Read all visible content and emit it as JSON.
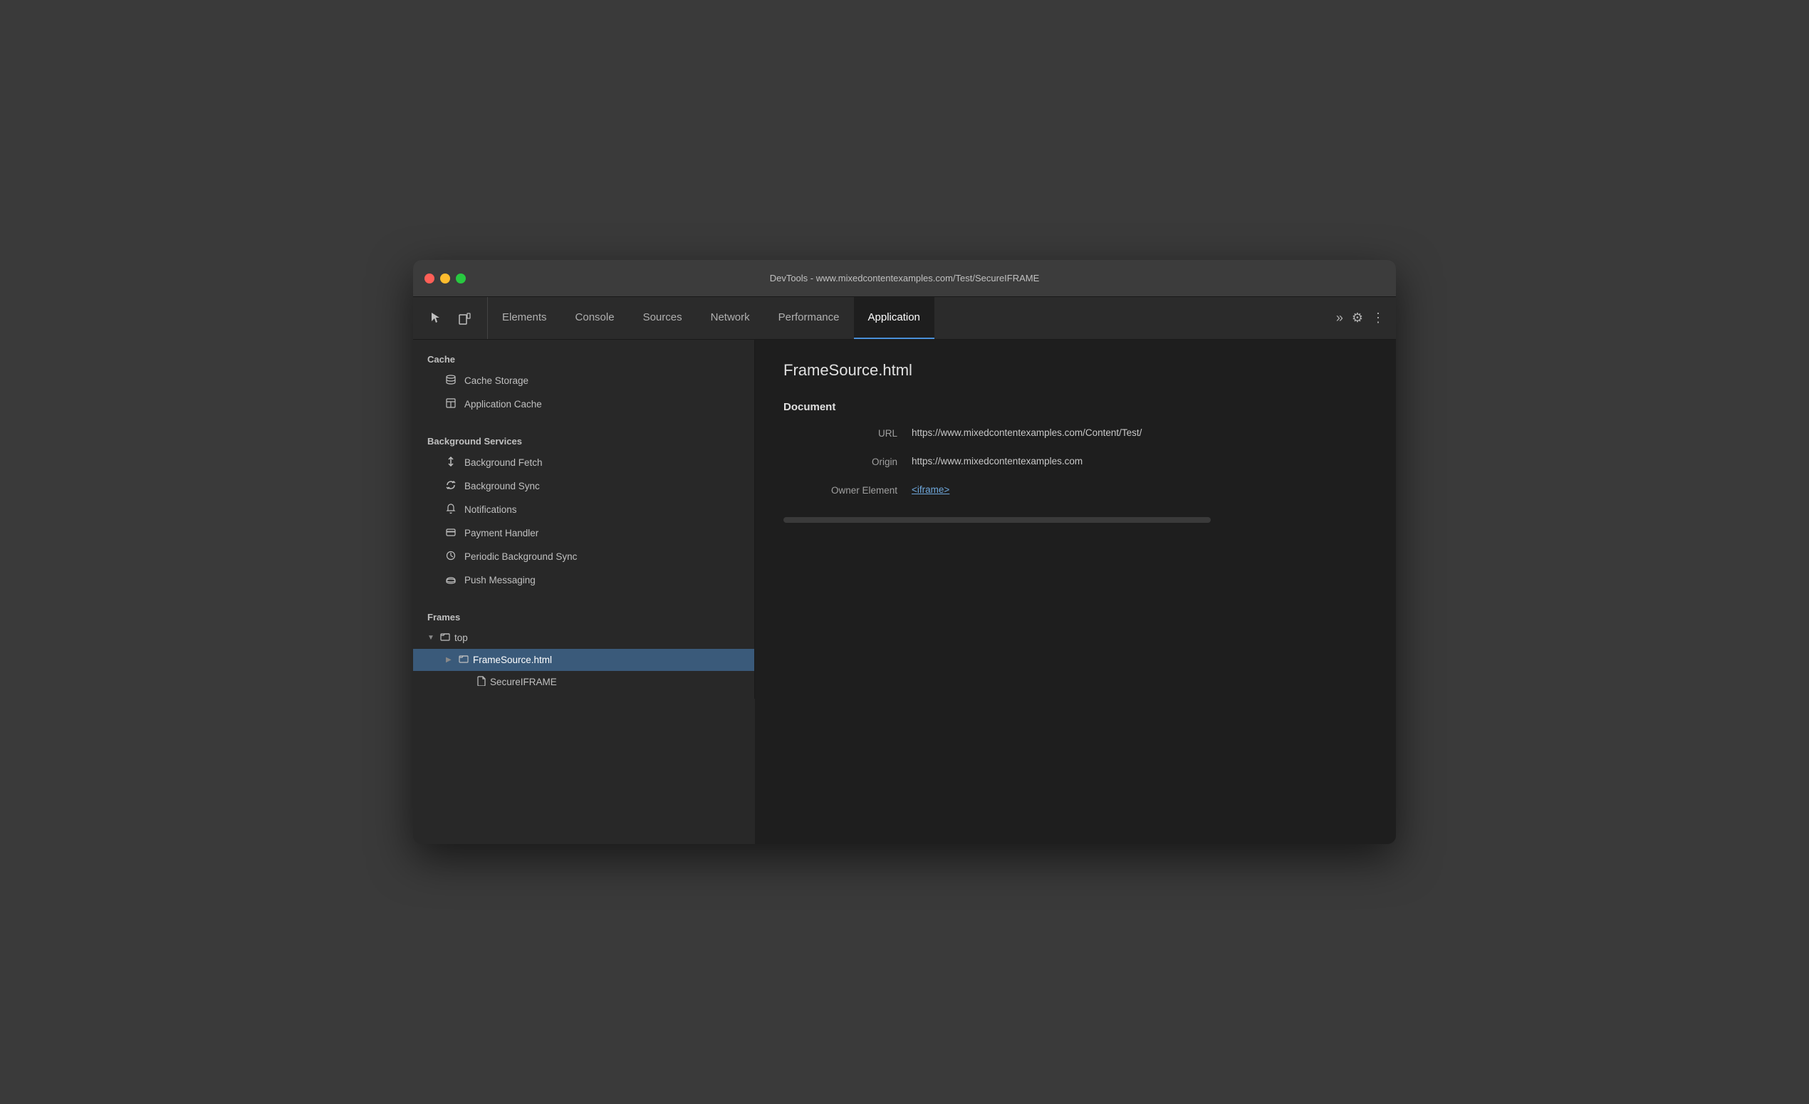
{
  "window": {
    "title": "DevTools - www.mixedcontentexamples.com/Test/SecureIFRAME"
  },
  "toolbar": {
    "inspect_icon": "⬚",
    "device_icon": "⬜",
    "tabs": [
      {
        "id": "elements",
        "label": "Elements",
        "active": false
      },
      {
        "id": "console",
        "label": "Console",
        "active": false
      },
      {
        "id": "sources",
        "label": "Sources",
        "active": false
      },
      {
        "id": "network",
        "label": "Network",
        "active": false
      },
      {
        "id": "performance",
        "label": "Performance",
        "active": false
      },
      {
        "id": "application",
        "label": "Application",
        "active": true
      }
    ],
    "more_tabs": "»",
    "settings_icon": "⚙",
    "more_icon": "⋮"
  },
  "sidebar": {
    "cache_header": "Cache",
    "cache_items": [
      {
        "id": "cache-storage",
        "icon": "🗄",
        "label": "Cache Storage"
      },
      {
        "id": "application-cache",
        "icon": "⊞",
        "label": "Application Cache"
      }
    ],
    "background_services_header": "Background Services",
    "background_service_items": [
      {
        "id": "background-fetch",
        "icon": "↕",
        "label": "Background Fetch"
      },
      {
        "id": "background-sync",
        "icon": "↻",
        "label": "Background Sync"
      },
      {
        "id": "notifications",
        "icon": "🔔",
        "label": "Notifications"
      },
      {
        "id": "payment-handler",
        "icon": "⊟",
        "label": "Payment Handler"
      },
      {
        "id": "periodic-background-sync",
        "icon": "⊙",
        "label": "Periodic Background Sync"
      },
      {
        "id": "push-messaging",
        "icon": "☁",
        "label": "Push Messaging"
      }
    ],
    "frames_header": "Frames",
    "frames_tree": {
      "top": {
        "label": "top",
        "expanded": true,
        "children": [
          {
            "id": "framesource",
            "label": "FrameSource.html",
            "expanded": false,
            "selected": true,
            "children": []
          },
          {
            "id": "secureiframe",
            "label": "SecureIFRAME",
            "is_file": true
          }
        ]
      }
    }
  },
  "content": {
    "title": "FrameSource.html",
    "document_section": "Document",
    "fields": [
      {
        "label": "URL",
        "value": "https://www.mixedcontentexamples.com/Content/Test/",
        "is_link": false
      },
      {
        "label": "Origin",
        "value": "https://www.mixedcontentexamples.com",
        "is_link": false
      },
      {
        "label": "Owner Element",
        "value": "<iframe>",
        "is_link": true
      }
    ]
  }
}
